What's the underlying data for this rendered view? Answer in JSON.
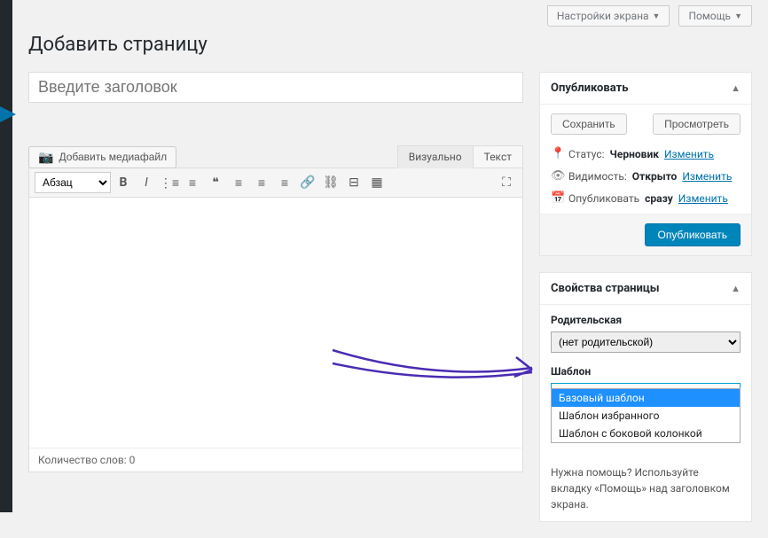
{
  "topbar": {
    "screen_options": "Настройки экрана",
    "help": "Помощь"
  },
  "page_title": "Добавить страницу",
  "title_placeholder": "Введите заголовок",
  "media_button": "Добавить медиафайл",
  "editor_tabs": {
    "visual": "Визуально",
    "text": "Текст"
  },
  "toolbar": {
    "paragraph": "Абзац"
  },
  "status_bar": "Количество слов: 0",
  "publish": {
    "box_title": "Опубликовать",
    "save": "Сохранить",
    "preview": "Просмотреть",
    "status_label": "Статус:",
    "status_value": "Черновик",
    "visibility_label": "Видимость:",
    "visibility_value": "Открыто",
    "publish_label": "Опубликовать",
    "publish_value": "сразу",
    "edit": "Изменить",
    "submit": "Опубликовать"
  },
  "attributes": {
    "box_title": "Свойства страницы",
    "parent_label": "Родительская",
    "parent_value": "(нет родительской)",
    "template_label": "Шаблон",
    "template_value": "Базовый шаблон",
    "template_options": [
      "Базовый шаблон",
      "Шаблон избранного",
      "Шаблон с боковой колонкой"
    ],
    "help_text": "Нужна помощь? Используйте вкладку «Помощь» над заголовком экрана."
  }
}
